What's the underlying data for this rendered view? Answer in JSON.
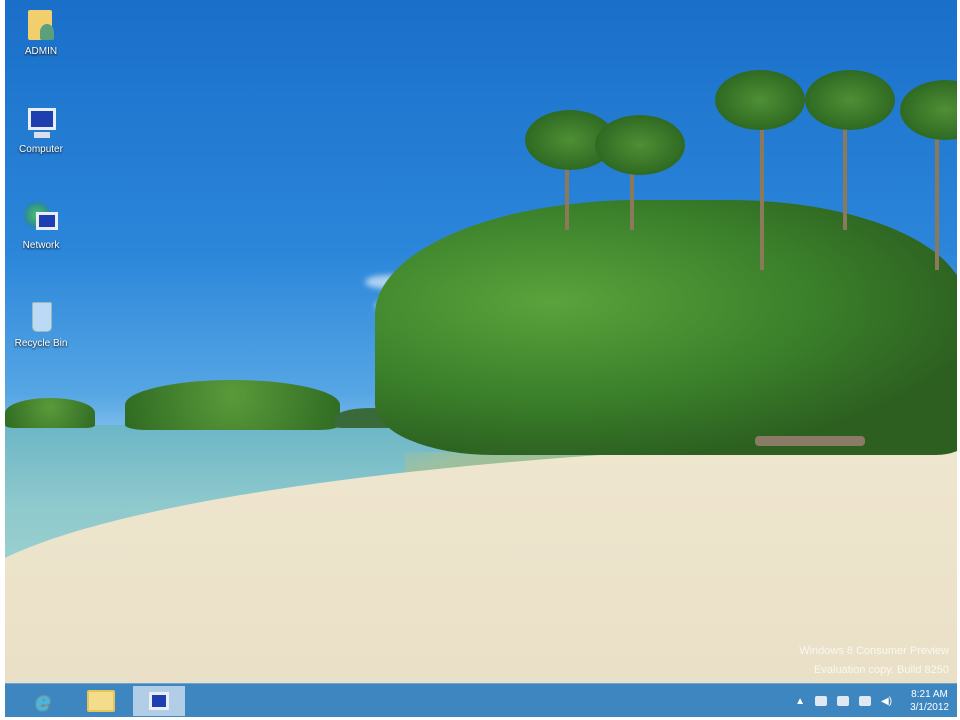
{
  "desktop": {
    "icons": [
      {
        "label": "ADMIN",
        "icon": "user-folder-icon"
      },
      {
        "label": "Computer",
        "icon": "computer-icon"
      },
      {
        "label": "Network",
        "icon": "network-icon"
      },
      {
        "label": "Recycle Bin",
        "icon": "recycle-bin-icon"
      }
    ]
  },
  "watermark": {
    "line1": "Windows 8 Consumer Preview",
    "line2": "Evaluation copy. Build 8250"
  },
  "taskbar": {
    "pinned": [
      {
        "name": "Internet Explorer",
        "icon": "internet-explorer-icon"
      },
      {
        "name": "File Explorer",
        "icon": "file-explorer-icon"
      },
      {
        "name": "Computer",
        "icon": "computer-icon"
      }
    ],
    "clock": {
      "time": "8:21 AM",
      "date": "3/1/2012"
    }
  },
  "colors": {
    "taskbar": "#3e86c0",
    "sky": "#1a6fc9"
  }
}
